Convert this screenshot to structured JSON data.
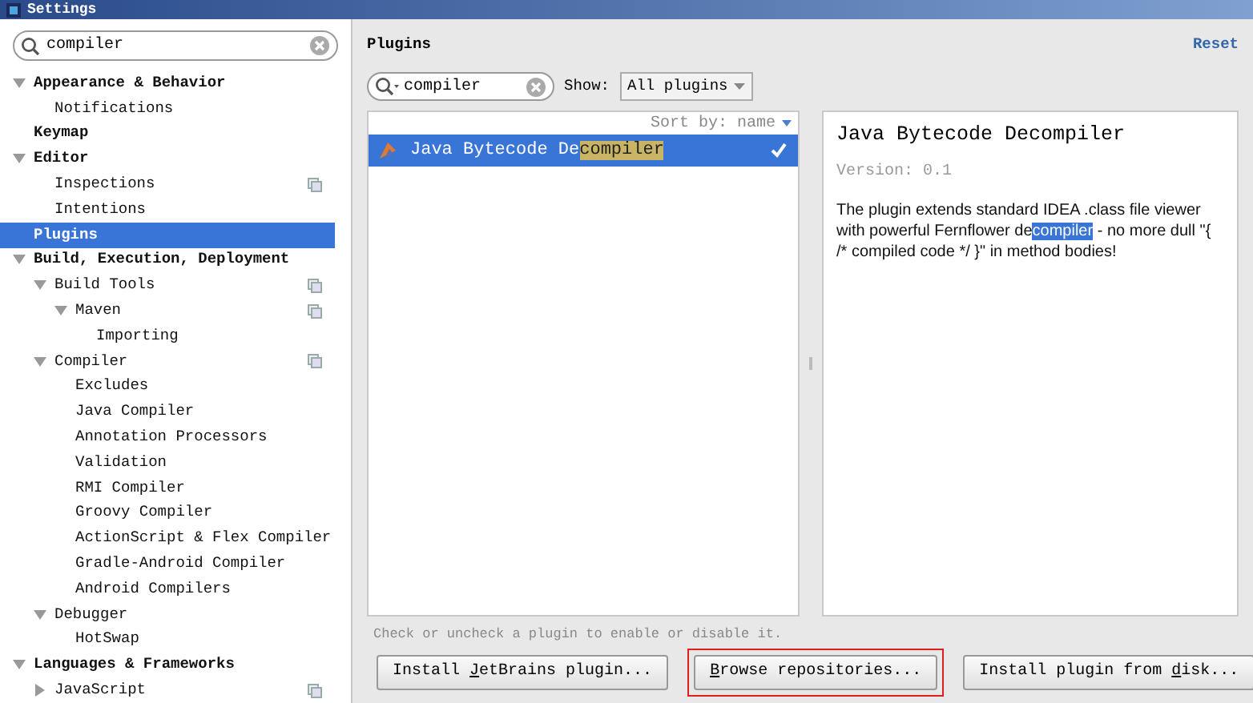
{
  "window": {
    "title": "Settings"
  },
  "sidebar": {
    "search": {
      "value": "compiler"
    },
    "tree": [
      {
        "label": "Appearance & Behavior",
        "expanded": true,
        "selected": false,
        "children": [
          {
            "label": "Notifications",
            "selected": false
          }
        ]
      },
      {
        "label": "Keymap",
        "selected": false
      },
      {
        "label": "Editor",
        "expanded": true,
        "selected": false,
        "children": [
          {
            "label": "Inspections",
            "selected": false,
            "project_scope": true
          },
          {
            "label": "Intentions",
            "selected": false
          }
        ]
      },
      {
        "label": "Plugins",
        "selected": true
      },
      {
        "label": "Build, Execution, Deployment",
        "expanded": true,
        "selected": false,
        "children": [
          {
            "label": "Build Tools",
            "expanded": true,
            "selected": false,
            "project_scope": true,
            "children": [
              {
                "label": "Maven",
                "expanded": true,
                "selected": false,
                "project_scope": true,
                "children": [
                  {
                    "label": "Importing",
                    "selected": false
                  }
                ]
              }
            ]
          },
          {
            "label": "Compiler",
            "expanded": true,
            "selected": false,
            "project_scope": true,
            "children": [
              {
                "label": "Excludes",
                "selected": false
              },
              {
                "label": "Java Compiler",
                "selected": false
              },
              {
                "label": "Annotation Processors",
                "selected": false
              },
              {
                "label": "Validation",
                "selected": false
              },
              {
                "label": "RMI Compiler",
                "selected": false
              },
              {
                "label": "Groovy Compiler",
                "selected": false
              },
              {
                "label": "ActionScript & Flex Compiler",
                "selected": false
              },
              {
                "label": "Gradle-Android Compiler",
                "selected": false
              },
              {
                "label": "Android Compilers",
                "selected": false
              }
            ]
          },
          {
            "label": "Debugger",
            "expanded": true,
            "selected": false,
            "children": [
              {
                "label": "HotSwap",
                "selected": false
              }
            ]
          }
        ]
      },
      {
        "label": "Languages & Frameworks",
        "expanded": true,
        "selected": false,
        "children": [
          {
            "label": "JavaScript",
            "expanded": false,
            "selected": false,
            "project_scope": true
          }
        ]
      }
    ]
  },
  "main": {
    "title": "Plugins",
    "reset": "Reset",
    "search": {
      "value": "compiler"
    },
    "show": {
      "label": "Show:",
      "value": "All plugins"
    },
    "sort": "Sort by: name",
    "plugins": [
      {
        "name_prefix": "Java Bytecode De",
        "name_match": "compiler",
        "selected": true,
        "checked": true
      }
    ],
    "detail": {
      "title": "Java Bytecode Decompiler",
      "version": "Version: 0.1",
      "description_before": "The plugin extends standard IDEA .class file viewer with powerful Fernflower de",
      "description_match": "compiler",
      "description_after": " - no more dull \"{ /* compiled code */ }\" in method bodies!"
    },
    "hint": "Check or uncheck a plugin to enable or disable it.",
    "buttons": [
      {
        "before": "Install ",
        "mnemonic": "J",
        "after": "etBrains plugin..."
      },
      {
        "mnemonic": "B",
        "after": "rowse repositories...",
        "highlighted": true
      },
      {
        "before": "Install plugin from ",
        "mnemonic": "d",
        "after": "isk..."
      }
    ]
  }
}
